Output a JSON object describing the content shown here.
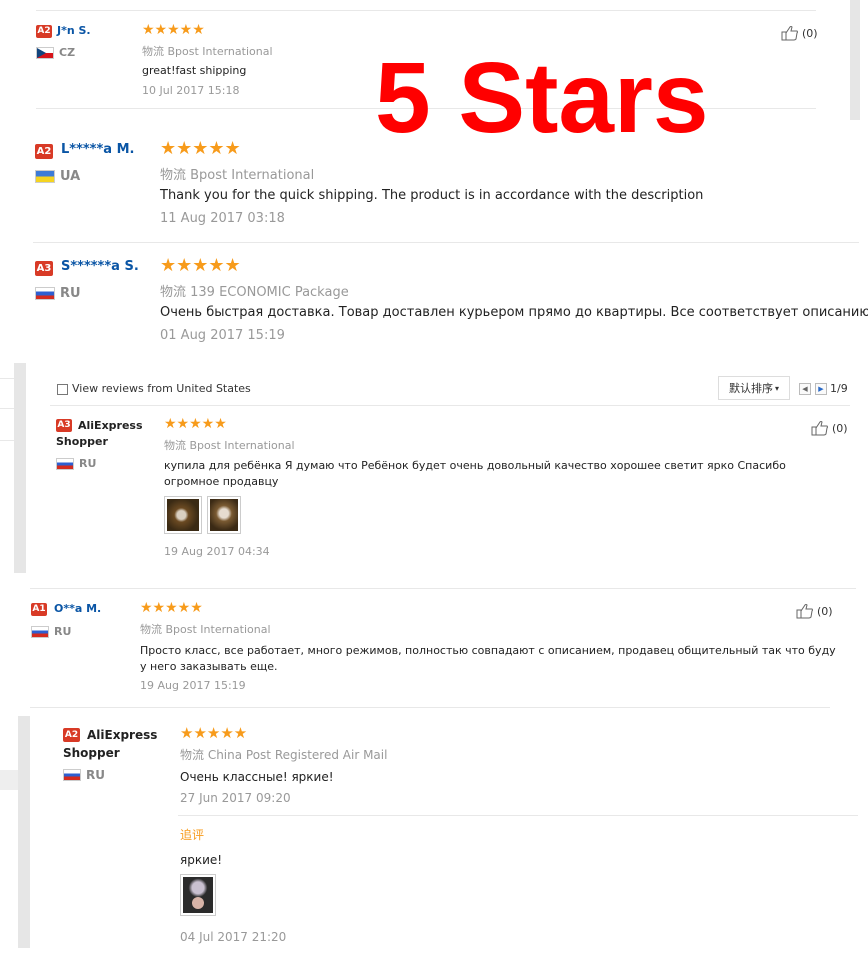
{
  "overlay": {
    "title": "5 Stars"
  },
  "stars": "★★★★★",
  "reviews": [
    {
      "level": "A2",
      "name": "J*n S.",
      "country": "CZ",
      "logistics": "物流 Bpost International",
      "comment": "great!fast shipping",
      "date": "10 Jul 2017 15:18",
      "likes": "(0)"
    },
    {
      "level": "A2",
      "name": "L*****a M.",
      "country": "UA",
      "logistics": "物流 Bpost International",
      "comment": "Thank you for the quick shipping. The product is in accordance with the description",
      "date": "11 Aug 2017 03:18"
    },
    {
      "level": "A3",
      "name": "S******a S.",
      "country": "RU",
      "logistics": "物流 139 ECONOMIC Package",
      "comment": "Очень быстрая доставка. Товар доставлен курьером прямо до квартиры. Все соответствует описанию.",
      "date": "01 Aug 2017 15:19"
    },
    {
      "level": "A3",
      "name": "AliExpress Shopper",
      "country": "RU",
      "logistics": "物流 Bpost International",
      "comment": "купила для ребёнка Я думаю что Ребёнок будет очень довольный качество хорошее светит ярко Спасибо огромное продавцу",
      "date": "19 Aug 2017 04:34",
      "likes": "(0)"
    },
    {
      "level": "A1",
      "name": "O**a M.",
      "country": "RU",
      "logistics": "物流 Bpost International",
      "comment": "Просто класс, все работает, много режимов, полностью совпадают с описанием, продавец общительный так что буду у него заказывать еще.",
      "date": "19 Aug 2017 15:19",
      "likes": "(0)"
    },
    {
      "level": "A2",
      "name": "AliExpress Shopper",
      "country": "RU",
      "logistics": "物流 China Post Registered Air Mail",
      "comment": "Очень классные! яркие!",
      "date": "27 Jun 2017 09:20",
      "followup_label": "追评",
      "followup_comment": "яркие!",
      "followup_date": "04 Jul 2017 21:20"
    }
  ],
  "toolbar": {
    "filter_label": "View reviews from United States",
    "sort_label": "默认排序",
    "pager_text": "1/9"
  }
}
